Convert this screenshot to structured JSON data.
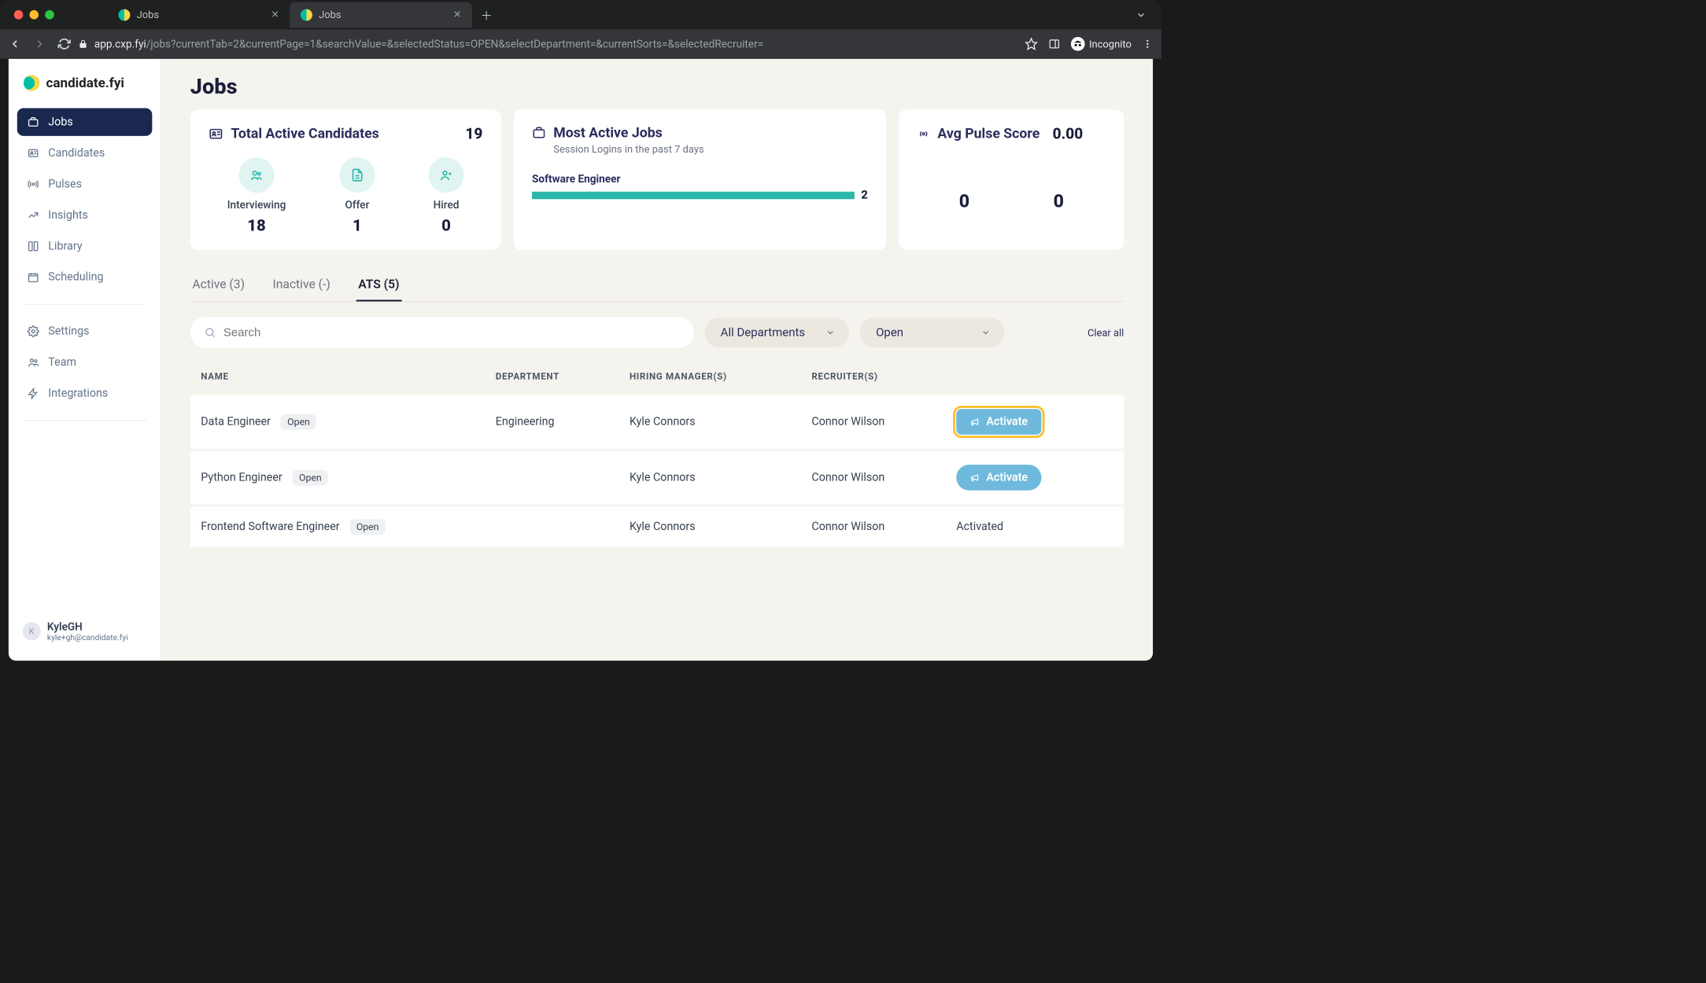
{
  "browser": {
    "tabs": [
      {
        "title": "Jobs",
        "active": false
      },
      {
        "title": "Jobs",
        "active": true
      }
    ],
    "url_host": "app.cxp.fyi",
    "url_path": "/jobs?currentTab=2&currentPage=1&searchValue=&selectedStatus=OPEN&selectDepartment=&currentSorts=&selectedRecruiter=",
    "incognito_label": "Incognito"
  },
  "brand": "candidate.fyi",
  "sidebar": {
    "items": [
      {
        "label": "Jobs",
        "icon": "briefcase",
        "active": true
      },
      {
        "label": "Candidates",
        "icon": "id-card"
      },
      {
        "label": "Pulses",
        "icon": "radio"
      },
      {
        "label": "Insights",
        "icon": "trend"
      },
      {
        "label": "Library",
        "icon": "book"
      },
      {
        "label": "Scheduling",
        "icon": "calendar"
      }
    ],
    "secondary": [
      {
        "label": "Settings",
        "icon": "gear"
      },
      {
        "label": "Team",
        "icon": "team"
      },
      {
        "label": "Integrations",
        "icon": "bolt"
      }
    ]
  },
  "user": {
    "initial": "K",
    "name": "KyleGH",
    "email": "kyle+gh@candidate.fyi"
  },
  "page": {
    "title": "Jobs"
  },
  "cards": {
    "total_active": {
      "title": "Total Active Candidates",
      "value": "19"
    },
    "stats": {
      "interviewing": {
        "label": "Interviewing",
        "value": "18"
      },
      "offer": {
        "label": "Offer",
        "value": "1"
      },
      "hired": {
        "label": "Hired",
        "value": "0"
      }
    },
    "most_active": {
      "title": "Most Active Jobs",
      "subtitle": "Session Logins in the past 7 days",
      "items": [
        {
          "name": "Software Engineer",
          "value": "2"
        }
      ]
    },
    "pulse": {
      "title": "Avg Pulse Score",
      "value": "0.00",
      "left": "0",
      "right": "0"
    }
  },
  "tabs": [
    {
      "label": "Active (3)"
    },
    {
      "label": "Inactive (-)"
    },
    {
      "label": "ATS (5)",
      "active": true
    }
  ],
  "filters": {
    "search_placeholder": "Search",
    "department": "All Departments",
    "status": "Open",
    "clear": "Clear all"
  },
  "table": {
    "headers": {
      "name": "Name",
      "dept": "Department",
      "hm": "Hiring Manager(s)",
      "rec": "Recruiter(s)"
    },
    "action_label": "Activate",
    "activated_label": "Activated",
    "badge_open": "Open",
    "rows": [
      {
        "name": "Data Engineer",
        "dept": "Engineering",
        "hm": "Kyle Connors",
        "rec": "Connor Wilson",
        "action": "activate",
        "highlight": true
      },
      {
        "name": "Python Engineer",
        "dept": "",
        "hm": "Kyle Connors",
        "rec": "Connor Wilson",
        "action": "activate"
      },
      {
        "name": "Frontend Software Engineer",
        "dept": "",
        "hm": "Kyle Connors",
        "rec": "Connor Wilson",
        "action": "activated"
      }
    ]
  }
}
